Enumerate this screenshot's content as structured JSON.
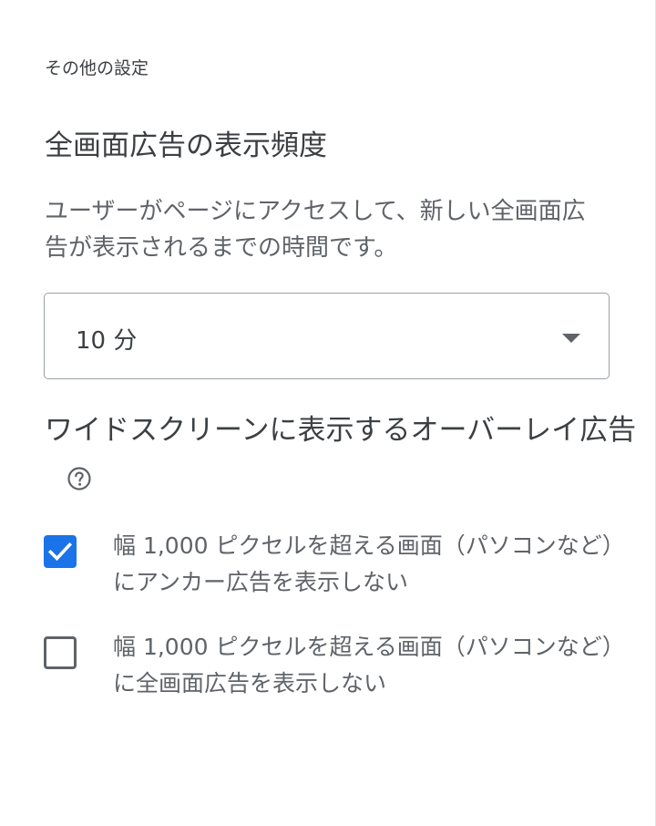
{
  "section_label": "その他の設定",
  "interstitial": {
    "heading": "全画面広告の表示頻度",
    "description": "ユーザーがページにアクセスして、新しい全画面広告が表示されるまでの時間です。",
    "frequency_select": {
      "selected_value": "10 分"
    }
  },
  "overlay": {
    "heading": "ワイドスクリーンに表示するオーバーレイ広告",
    "help_icon": "help-circle-icon",
    "options": [
      {
        "label": "幅 1,000 ピクセルを超える画面（パソコンなど）にアンカー広告を表示しない",
        "checked": true
      },
      {
        "label": "幅 1,000 ピクセルを超える画面（パソコンなど）に全画面広告を表示しない",
        "checked": false
      }
    ]
  },
  "colors": {
    "accent": "#1a73e8",
    "text": "#3c4043",
    "secondary_text": "#5f6368",
    "border": "#9aa0a6"
  }
}
